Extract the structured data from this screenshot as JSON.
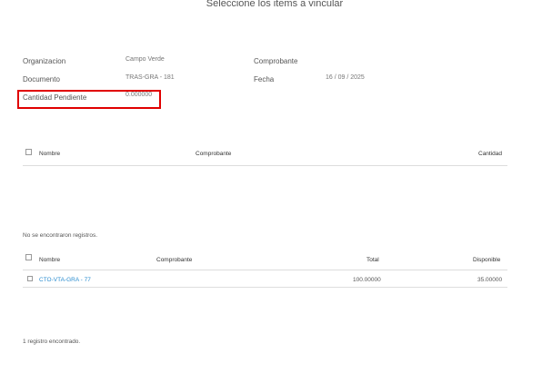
{
  "title": "Seleccione los items a vincular",
  "form": {
    "organizacion_label": "Organizacion",
    "organizacion_value": "Campo Verde",
    "documento_label": "Documento",
    "documento_value": "TRAS-GRA - 181",
    "cantidad_label": "Cantidad Pendiente",
    "cantidad_value": "0.000000",
    "comprobante_label": "Comprobante",
    "comprobante_value": "",
    "fecha_label": "Fecha",
    "fecha_value": "16 / 09 / 2025"
  },
  "table1": {
    "headers": {
      "nombre": "Nombre",
      "comprobante": "Comprobante",
      "cantidad": "Cantidad"
    },
    "empty_message": "No se encontraron registros."
  },
  "table2": {
    "headers": {
      "nombre": "Nombre",
      "comprobante": "Comprobante",
      "total": "Total",
      "disponible": "Disponible"
    },
    "rows": [
      {
        "nombre": "CTO-VTA-GRA - 77",
        "comprobante": "",
        "total": "100.00000",
        "disponible": "35.00000"
      }
    ],
    "footer": "1 registro encontrado."
  },
  "colors": {
    "highlight": "#e00000",
    "link": "#2a8ccf"
  }
}
